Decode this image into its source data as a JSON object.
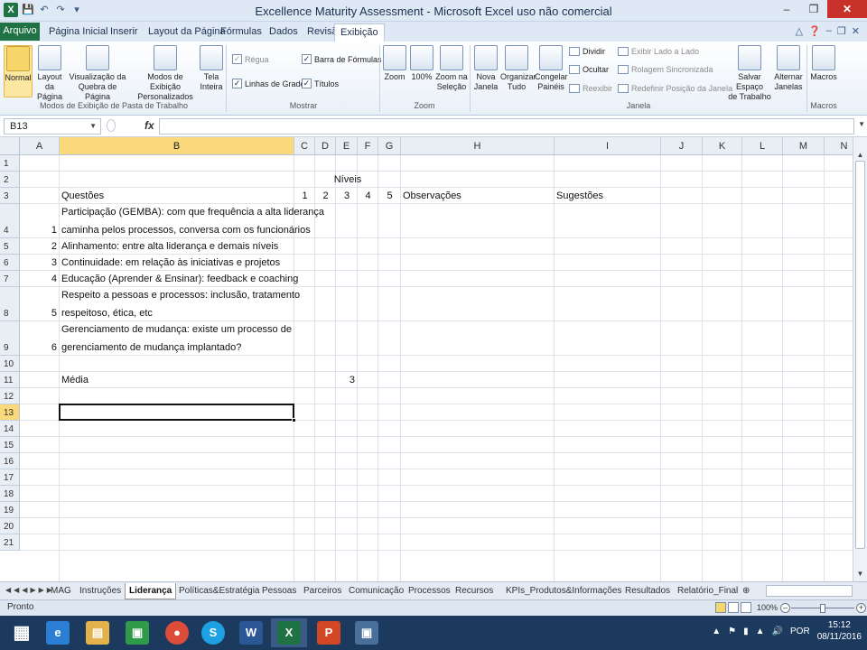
{
  "window": {
    "title": "Excellence Maturity Assessment - Microsoft Excel uso não comercial",
    "app_icon": "X"
  },
  "tabs": [
    "Arquivo",
    "Página Inicial",
    "Inserir",
    "Layout da Página",
    "Fórmulas",
    "Dados",
    "Revisão",
    "Exibição"
  ],
  "active_tab": "Exibição",
  "ribbon": {
    "groups": {
      "workbook_views": "Modos de Exibição de Pasta de Trabalho",
      "show": "Mostrar",
      "zoom": "Zoom",
      "window": "Janela",
      "macros": "Macros"
    },
    "normal": "Normal",
    "page_layout_1": "Layout da",
    "page_layout_2": "Página",
    "page_break_1": "Visualização da",
    "page_break_2": "Quebra de Página",
    "custom_views_1": "Modos de Exibição",
    "custom_views_2": "Personalizados",
    "full_screen_1": "Tela",
    "full_screen_2": "Inteira",
    "ruler": "Régua",
    "gridlines": "Linhas de Grade",
    "formula_bar": "Barra de Fórmulas",
    "headings": "Títulos",
    "zoom_btn": "Zoom",
    "zoom_100": "100%",
    "zoom_sel_1": "Zoom na",
    "zoom_sel_2": "Seleção",
    "new_window_1": "Nova",
    "new_window_2": "Janela",
    "arrange_1": "Organizar",
    "arrange_2": "Tudo",
    "freeze_1": "Congelar",
    "freeze_2": "Painéis",
    "split": "Dividir",
    "hide": "Ocultar",
    "unhide": "Reexibir",
    "side_by_side": "Exibir Lado a Lado",
    "sync_scroll": "Rolagem Sincronizada",
    "reset_pos": "Redefinir Posição da Janela",
    "save_ws_1": "Salvar Espaço",
    "save_ws_2": "de Trabalho",
    "switch_1": "Alternar",
    "switch_2": "Janelas",
    "macros_btn": "Macros"
  },
  "formula_bar": {
    "name_box": "B13",
    "fx": "fx",
    "value": ""
  },
  "columns": [
    "A",
    "B",
    "C",
    "D",
    "E",
    "F",
    "G",
    "H",
    "I",
    "J",
    "K",
    "L",
    "M",
    "N"
  ],
  "rows": [
    "1",
    "2",
    "3",
    "4",
    "5",
    "6",
    "7",
    "8",
    "9",
    "10",
    "11",
    "12",
    "13",
    "14",
    "15",
    "16",
    "17",
    "18",
    "19",
    "20",
    "21"
  ],
  "sheet": {
    "niveis": "Níveis",
    "questoes": "Questões",
    "levels": [
      "1",
      "2",
      "3",
      "4",
      "5"
    ],
    "observacoes": "Observações",
    "sugestoes": "Sugestões",
    "questions": [
      {
        "num": "1",
        "line1": "Participação (GEMBA): com que frequência a alta liderança",
        "line2": "caminha pelos processos, conversa com os funcionários"
      },
      {
        "num": "2",
        "line1": "Alinhamento: entre alta liderança e demais níveis"
      },
      {
        "num": "3",
        "line1": "Continuidade: em relação às iniciativas e projetos"
      },
      {
        "num": "4",
        "line1": "Educação (Aprender & Ensinar): feedback e coaching"
      },
      {
        "num": "5",
        "line1": "Respeito a pessoas e processos: inclusão, tratamento",
        "line2": "respeitoso, ética, etc"
      },
      {
        "num": "6",
        "line1": "Gerenciamento de mudança: existe um processo de",
        "line2": "gerenciamento de mudança implantado?"
      }
    ],
    "media_label": "Média",
    "media_value": "3"
  },
  "sheet_tabs": [
    "MAG",
    "Instruções",
    "Liderança",
    "Políticas&Estratégia",
    "Pessoas",
    "Parceiros",
    "Comunicação",
    "Processos",
    "Recursos",
    "KPIs_Produtos&Informações",
    "Resultados",
    "Relatório_Final"
  ],
  "active_sheet": "Liderança",
  "status": {
    "ready": "Pronto",
    "zoom": "100%"
  },
  "taskbar": {
    "lang": "POR",
    "time": "15:12",
    "date": "08/11/2016"
  }
}
